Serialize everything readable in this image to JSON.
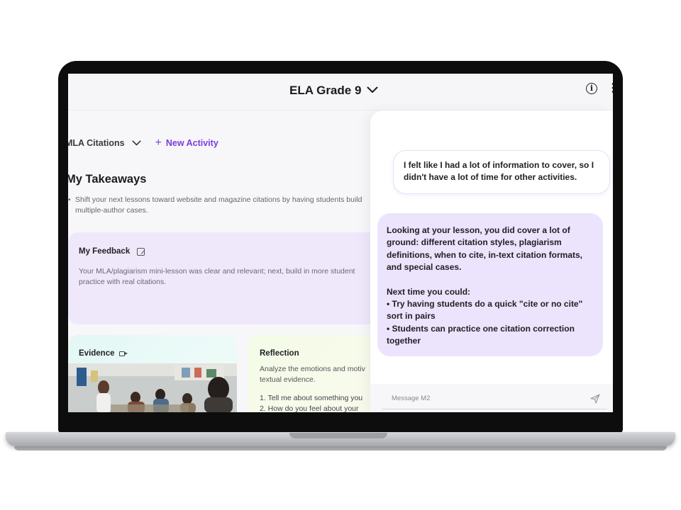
{
  "header": {
    "course_title": "ELA Grade 9"
  },
  "activity": {
    "selected": "MLA Citations",
    "new_activity_label": "New Activity"
  },
  "takeaways": {
    "title": "My Takeaways",
    "bullet": "Shift your next lessons toward website and magazine citations by having students build multiple-author cases."
  },
  "feedback": {
    "title": "My Feedback",
    "text": "Your MLA/plagiarism mini-lesson was clear and relevant; next, build in more student practice with real citations."
  },
  "evidence": {
    "title": "Evidence"
  },
  "reflection": {
    "title": "Reflection",
    "desc_line1": "Analyze the emotions and motiv",
    "desc_line2": "textual evidence.",
    "item1": "1.  Tell me about something you",
    "item2": "2.  How do you feel about your"
  },
  "chat": {
    "user_message": "I felt like I had a lot of information to cover, so I didn't have a lot of time for other activities.",
    "assistant_p1": "Looking at your lesson, you did cover a lot of ground: different citation styles, plagiarism definitions, when to cite, in-text citation formats, and special cases.",
    "assistant_p2": "Next time you could:",
    "assistant_b1": "• Try having students do a quick \"cite or no cite\" sort in pairs",
    "assistant_b2": "• Students can practice one citation correction together",
    "input_placeholder": "Message M2"
  },
  "colors": {
    "accent": "#7a3ee0",
    "assistant_bubble": "#ece3fc",
    "feedback_card": "#efe8fb"
  }
}
